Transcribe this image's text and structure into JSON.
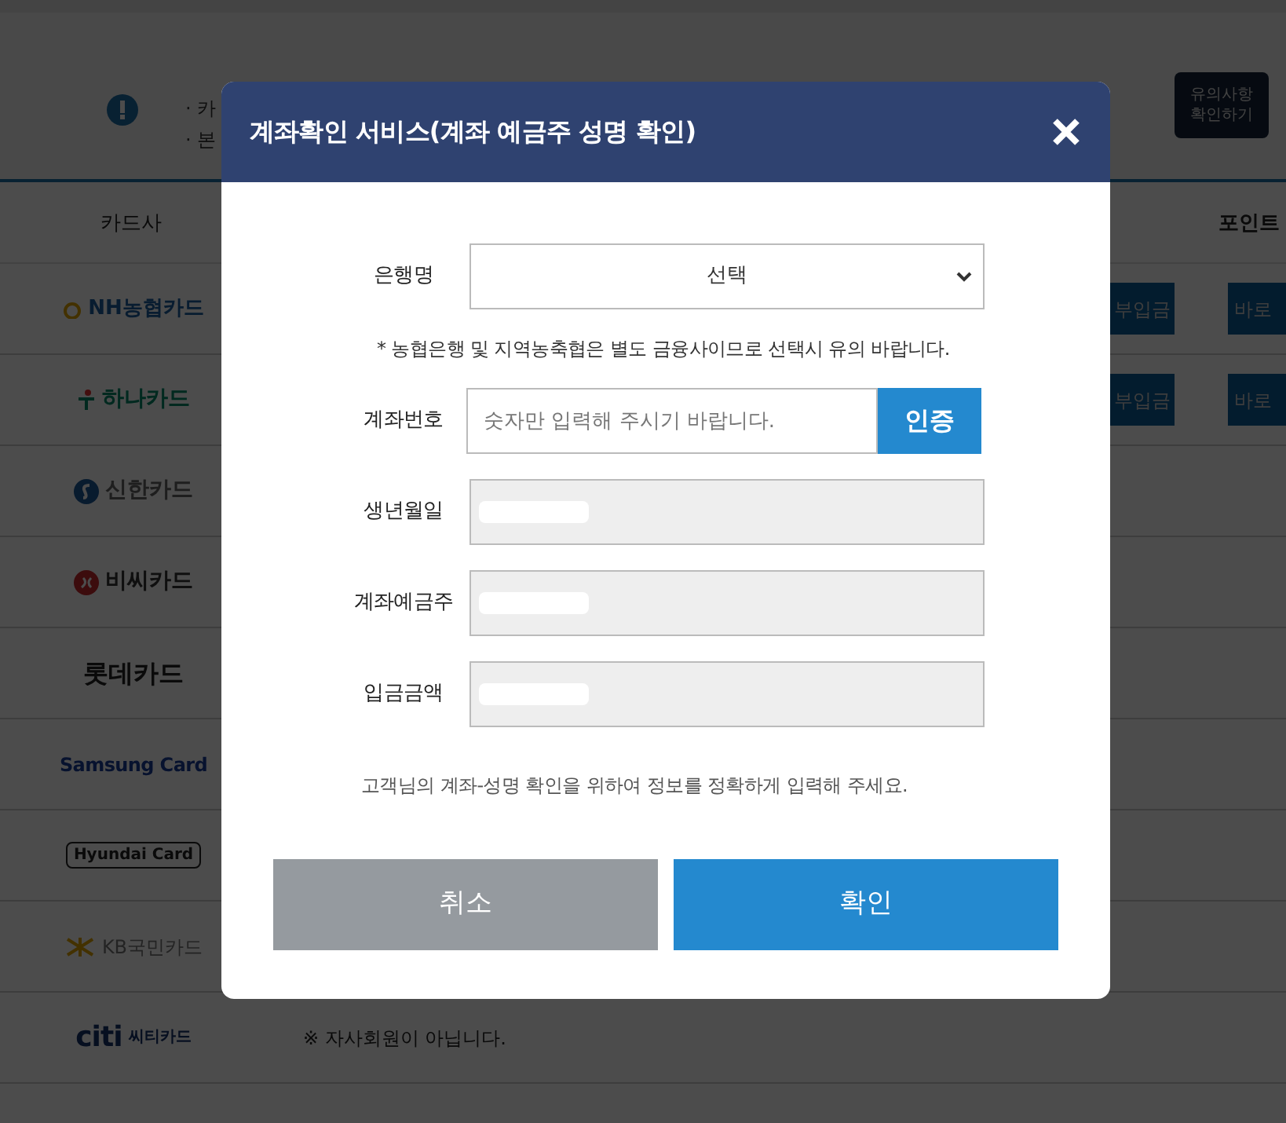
{
  "notice": {
    "bullets": [
      "· 카",
      "· 본"
    ],
    "button": "유의사항 확인하기"
  },
  "table": {
    "columns": [
      "카드사",
      "포인트"
    ],
    "rows": [
      {
        "card": "NH농협카드",
        "kind": "nh",
        "actions": [
          "부입금",
          "바로"
        ]
      },
      {
        "card": "하나카드",
        "kind": "hana",
        "actions": [
          "부입금",
          "바로"
        ]
      },
      {
        "card": "신한카드",
        "kind": "shinhan"
      },
      {
        "card": "비씨카드",
        "kind": "bc"
      },
      {
        "card": "롯데카드",
        "kind": "lotte"
      },
      {
        "card": "Samsung Card",
        "kind": "samsung"
      },
      {
        "card": "Hyundai Card",
        "kind": "hyundai"
      },
      {
        "card": "KB국민카드",
        "kind": "kb"
      },
      {
        "card": "씨티카드",
        "kind": "citi",
        "logo_text": "citi",
        "note": "※ 자사회원이 아닙니다."
      }
    ]
  },
  "dialog": {
    "title": "계좌확인 서비스(계좌 예금주 성명 확인)",
    "fields": [
      {
        "kind": "select",
        "label": "은행명",
        "value": "선택"
      },
      {
        "kind": "note",
        "text": "* 농협은행 및 지역농축협은 별도 금융사이므로 선택시 유의 바랍니다."
      },
      {
        "kind": "input",
        "label": "계좌번호",
        "placeholder": "숫자만 입력해 주시기 바랍니다.",
        "button": "인증"
      },
      {
        "kind": "readonly",
        "label": "생년월일",
        "redacted": true
      },
      {
        "kind": "readonly",
        "label": "계좌예금주",
        "redacted": true
      },
      {
        "kind": "readonly",
        "label": "입금금액",
        "redacted": true
      }
    ],
    "footer_note": "고객님의 계좌-성명 확인을 위하여 정보를 정확하게 입력해 주세요.",
    "buttons": [
      {
        "label": "취소",
        "kind": "cancel"
      },
      {
        "label": "확인",
        "kind": "confirm"
      }
    ]
  }
}
